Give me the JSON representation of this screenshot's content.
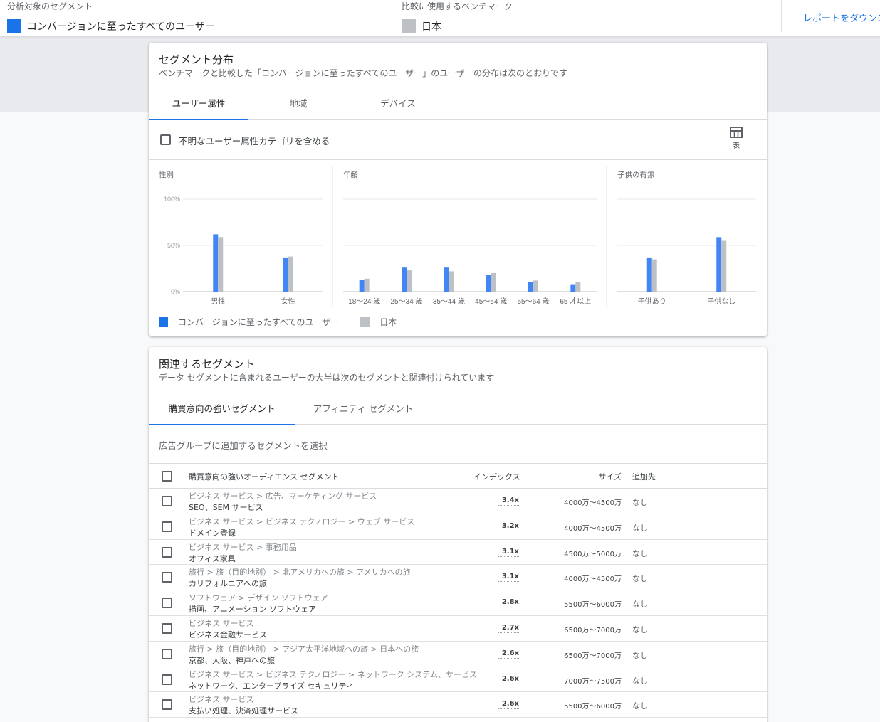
{
  "header": {
    "segment_label": "分析対象のセグメント",
    "segment_value": "コンバージョンに至ったすべてのユーザー",
    "segment_color": "#1a73e8",
    "benchmark_label": "比較に使用するベンチマーク",
    "benchmark_value": "日本",
    "benchmark_color": "#bdc1c6",
    "download_link": "レポートをダウンロード"
  },
  "distribution": {
    "title": "セグメント分布",
    "subtitle": "ベンチマークと比較した「コンバージョンに至ったすべてのユーザー」のユーザーの分布は次のとおりです",
    "tabs": [
      {
        "label": "ユーザー属性",
        "active": true
      },
      {
        "label": "地域",
        "active": false
      },
      {
        "label": "デバイス",
        "active": false
      }
    ],
    "include_unknown_label": "不明なユーザー属性カテゴリを含める",
    "table_icon": "table-icon",
    "table_label": "表",
    "legend": [
      "コンバージョンに至ったすべてのユーザー",
      "日本"
    ]
  },
  "chart_data": [
    {
      "type": "bar",
      "title": "性別",
      "categories": [
        "男性",
        "女性"
      ],
      "series": [
        {
          "name": "コンバージョンに至ったすべてのユーザー",
          "values": [
            62,
            37
          ],
          "color": "#4285f4"
        },
        {
          "name": "日本",
          "values": [
            59,
            38
          ],
          "color": "#bdc1c6"
        }
      ],
      "ylim": [
        0,
        100
      ],
      "yticks": [
        "0%",
        "50%",
        "100%"
      ],
      "grid": true
    },
    {
      "type": "bar",
      "title": "年齢",
      "categories": [
        "18～24 歳",
        "25～34 歳",
        "35～44 歳",
        "45～54 歳",
        "55～64 歳",
        "65 才以上"
      ],
      "series": [
        {
          "name": "コンバージョンに至ったすべてのユーザー",
          "values": [
            13,
            26,
            26,
            18,
            10,
            8
          ],
          "color": "#4285f4"
        },
        {
          "name": "日本",
          "values": [
            14,
            23,
            22,
            20,
            12,
            10
          ],
          "color": "#bdc1c6"
        }
      ],
      "ylim": [
        0,
        100
      ],
      "grid": true
    },
    {
      "type": "bar",
      "title": "子供の有無",
      "categories": [
        "子供あり",
        "子供なし"
      ],
      "series": [
        {
          "name": "コンバージョンに至ったすべてのユーザー",
          "values": [
            37,
            59
          ],
          "color": "#4285f4"
        },
        {
          "name": "日本",
          "values": [
            35,
            55
          ],
          "color": "#bdc1c6"
        }
      ],
      "ylim": [
        0,
        100
      ],
      "grid": true
    }
  ],
  "related": {
    "title": "関連するセグメント",
    "subtitle": "データ セグメントに含まれるユーザーの大半は次のセグメントと関連付けられています",
    "tabs": [
      {
        "label": "購買意向の強いセグメント",
        "active": true
      },
      {
        "label": "アフィニティ セグメント",
        "active": false
      }
    ],
    "select_label": "広告グループに追加するセグメントを選択",
    "columns": {
      "segment": "購買意向の強いオーディエンス セグメント",
      "index": "インデックス",
      "size": "サイズ",
      "add_to": "追加先"
    },
    "rows": [
      {
        "path": "ビジネス サービス > 広告、マーケティング サービス",
        "name": "SEO、SEM サービス",
        "index": "3.4x",
        "size": "4000万～4500万",
        "add_to": "なし"
      },
      {
        "path": "ビジネス サービス > ビジネス テクノロジー > ウェブ サービス",
        "name": "ドメイン登録",
        "index": "3.2x",
        "size": "4000万～4500万",
        "add_to": "なし"
      },
      {
        "path": "ビジネス サービス > 事務用品",
        "name": "オフィス家具",
        "index": "3.1x",
        "size": "4500万～5000万",
        "add_to": "なし"
      },
      {
        "path": "旅行 > 旅（目的地別） > 北アメリカへの旅 > アメリカへの旅",
        "name": "カリフォルニアへの旅",
        "index": "3.1x",
        "size": "4000万～4500万",
        "add_to": "なし"
      },
      {
        "path": "ソフトウェア > デザイン ソフトウェア",
        "name": "描画、アニメーション ソフトウェア",
        "index": "2.8x",
        "size": "5500万～6000万",
        "add_to": "なし"
      },
      {
        "path": "ビジネス サービス",
        "name": "ビジネス金融サービス",
        "index": "2.7x",
        "size": "6500万～7000万",
        "add_to": "なし"
      },
      {
        "path": "旅行 > 旅（目的地別） > アジア太平洋地域への旅 > 日本への旅",
        "name": "京都、大阪、神戸への旅",
        "index": "2.6x",
        "size": "6500万～7000万",
        "add_to": "なし"
      },
      {
        "path": "ビジネス サービス > ビジネス テクノロジー > ネットワーク システム、サービス",
        "name": "ネットワーク、エンタープライズ セキュリティ",
        "index": "2.6x",
        "size": "7000万～7500万",
        "add_to": "なし"
      },
      {
        "path": "ビジネス サービス",
        "name": "支払い処理、決済処理サービス",
        "index": "2.6x",
        "size": "5500万～6000万",
        "add_to": "なし"
      }
    ]
  }
}
